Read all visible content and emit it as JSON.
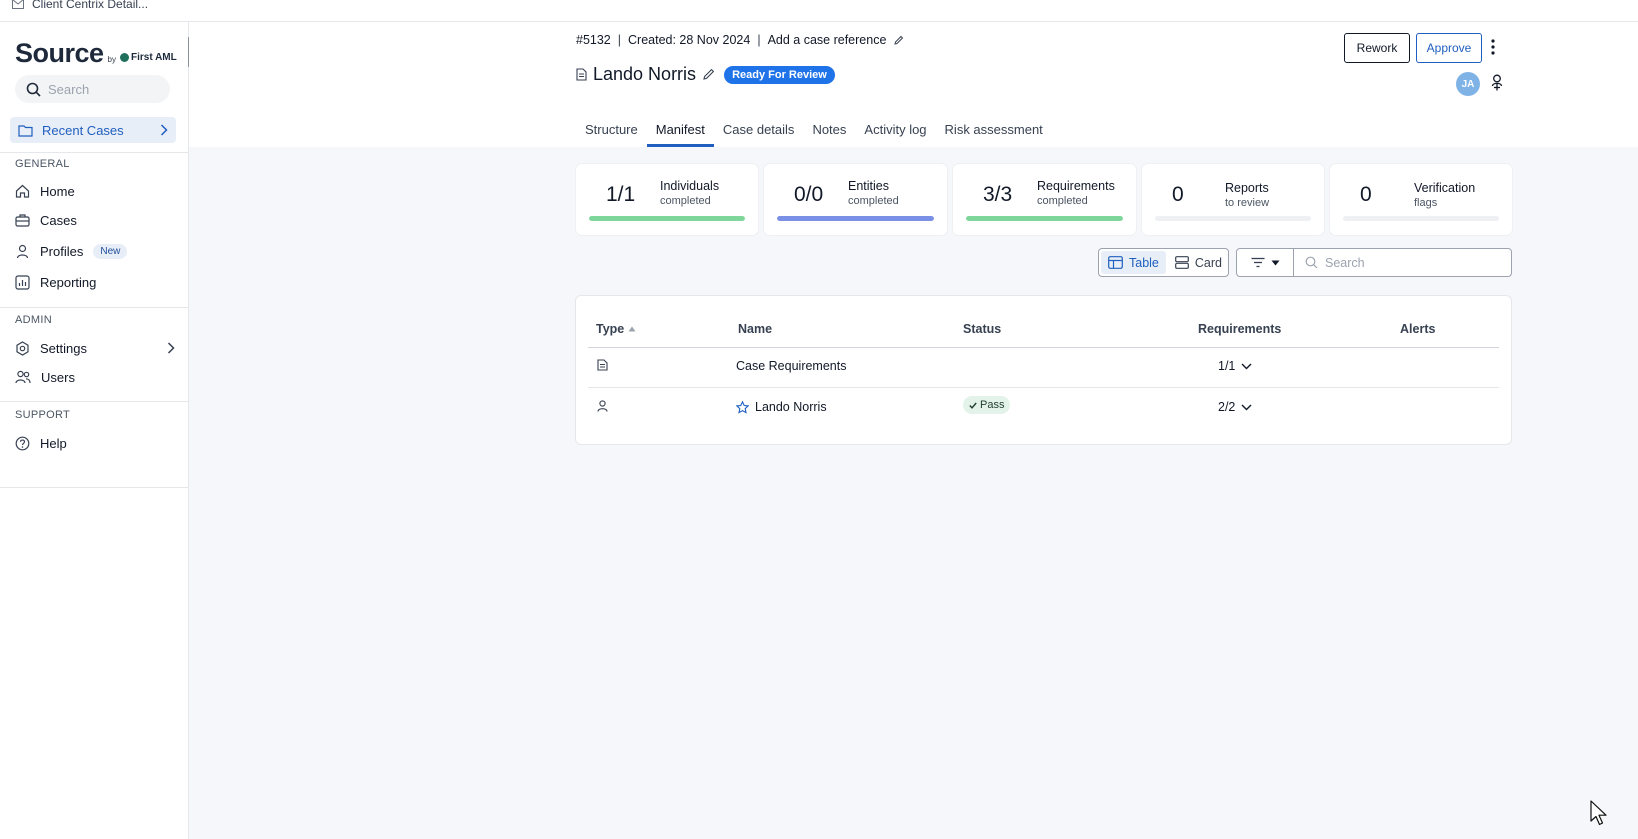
{
  "window": {
    "title": "Client Centrix Detail..."
  },
  "sidebar": {
    "logo": {
      "word": "Source",
      "by": "by",
      "firm": "First AML"
    },
    "search_placeholder": "Search",
    "recent_cases": "Recent Cases",
    "sections": [
      {
        "title": "GENERAL"
      },
      {
        "title": "ADMIN"
      },
      {
        "title": "SUPPORT"
      }
    ],
    "items": {
      "home": "Home",
      "cases": "Cases",
      "profiles": "Profiles",
      "profiles_badge": "New",
      "reporting": "Reporting",
      "settings": "Settings",
      "users": "Users",
      "help": "Help"
    }
  },
  "header": {
    "case_id": "#5132",
    "separator": "|",
    "created": "Created: 28 Nov 2024",
    "case_reference": "Add a case reference",
    "case_name": "Lando Norris",
    "status": "Ready For Review",
    "rework": "Rework",
    "approve": "Approve",
    "avatar_initials": "JA",
    "tabs": [
      "Structure",
      "Manifest",
      "Case details",
      "Notes",
      "Activity log",
      "Risk assessment"
    ],
    "active_tab": "Manifest"
  },
  "stats": [
    {
      "value": "1/1",
      "label": "Individuals",
      "sub": "completed",
      "progress": 1.0,
      "color": "#7ed69b"
    },
    {
      "value": "0/0",
      "label": "Entities",
      "sub": "completed",
      "progress": 1.0,
      "color": "#7a8fe6"
    },
    {
      "value": "3/3",
      "label": "Requirements",
      "sub": "completed",
      "progress": 1.0,
      "color": "#7ed69b"
    },
    {
      "value": "0",
      "label": "Reports",
      "sub": "to review",
      "progress": 0,
      "color": "#eef0f3"
    },
    {
      "value": "0",
      "label": "Verification",
      "sub": "flags",
      "progress": 0,
      "color": "#eef0f3"
    }
  ],
  "toolbar": {
    "view_table": "Table",
    "view_card": "Card",
    "search_placeholder": "Search"
  },
  "table": {
    "columns": [
      "Type",
      "Name",
      "Status",
      "Requirements",
      "Alerts"
    ],
    "rows": [
      {
        "type_icon": "document-icon",
        "name": "Case Requirements",
        "status": "",
        "requirements": "1/1",
        "alerts": ""
      },
      {
        "type_icon": "person-icon",
        "name": "Lando Norris",
        "status": "Pass",
        "requirements": "2/2",
        "alerts": ""
      }
    ]
  },
  "colors": {
    "accent": "#1f5fbf",
    "status_pill": "#1f73e8",
    "pass_bg": "#e3f3ea"
  }
}
